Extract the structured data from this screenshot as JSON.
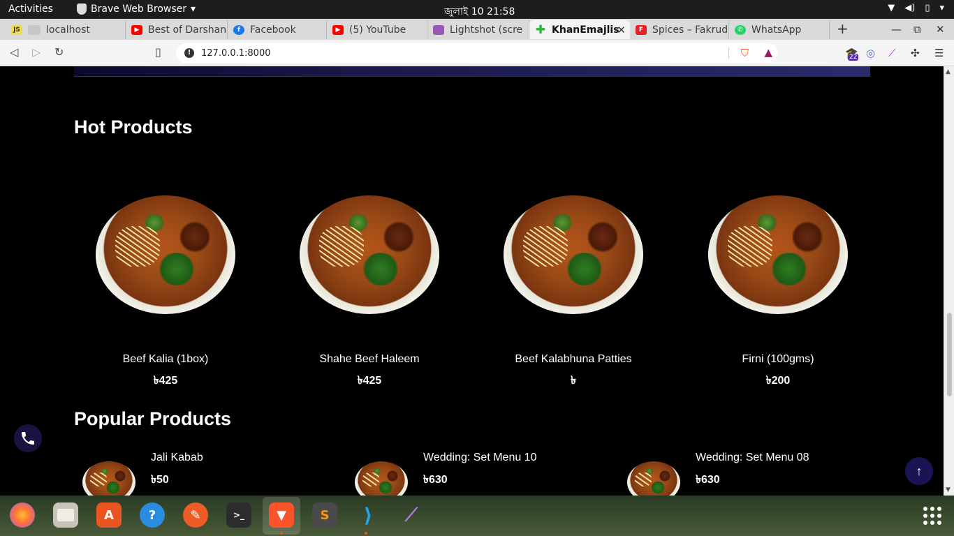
{
  "topbar": {
    "activities": "Activities",
    "app_name": "Brave Web Browser",
    "clock": "জুলাই 10  21:58"
  },
  "tabs": [
    {
      "label": "localhost"
    },
    {
      "label": "Best of Darshan"
    },
    {
      "label": "Facebook"
    },
    {
      "label": "(5) YouTube"
    },
    {
      "label": "Lightshot (scre"
    },
    {
      "label": "KhanEmajlis",
      "active": true
    },
    {
      "label": "Spices – Fakrud"
    },
    {
      "label": "WhatsApp"
    }
  ],
  "toolbar": {
    "url": "127.0.0.1:8000",
    "rewards_count": "22"
  },
  "page": {
    "hot_title": "Hot Products",
    "popular_title": "Popular Products",
    "currency": "৳",
    "hot_products": [
      {
        "name": "Beef Kalia (1box)",
        "price": "৳425"
      },
      {
        "name": "Shahe Beef Haleem",
        "price": "৳425"
      },
      {
        "name": "Beef Kalabhuna Patties",
        "price": "৳"
      },
      {
        "name": "Firni (100gms)",
        "price": "৳200"
      }
    ],
    "popular_products": [
      {
        "name": "Jali Kabab",
        "price": "৳50"
      },
      {
        "name": "Wedding: Set Menu 10",
        "price": "৳630"
      },
      {
        "name": "Wedding: Set Menu 08",
        "price": "৳630"
      }
    ],
    "back_to_top": "↑"
  },
  "colors": {
    "page_bg": "#000000",
    "call_button": "#1a1240",
    "top_button": "#1a1455",
    "accent_orange": "#e95420"
  },
  "dock_icons": [
    "firefox-icon",
    "files-icon",
    "software-icon",
    "help-icon",
    "postman-icon",
    "terminal-icon",
    "brave-icon",
    "sublime-icon",
    "vscode-icon",
    "feather-icon",
    "apps-grid-icon"
  ]
}
